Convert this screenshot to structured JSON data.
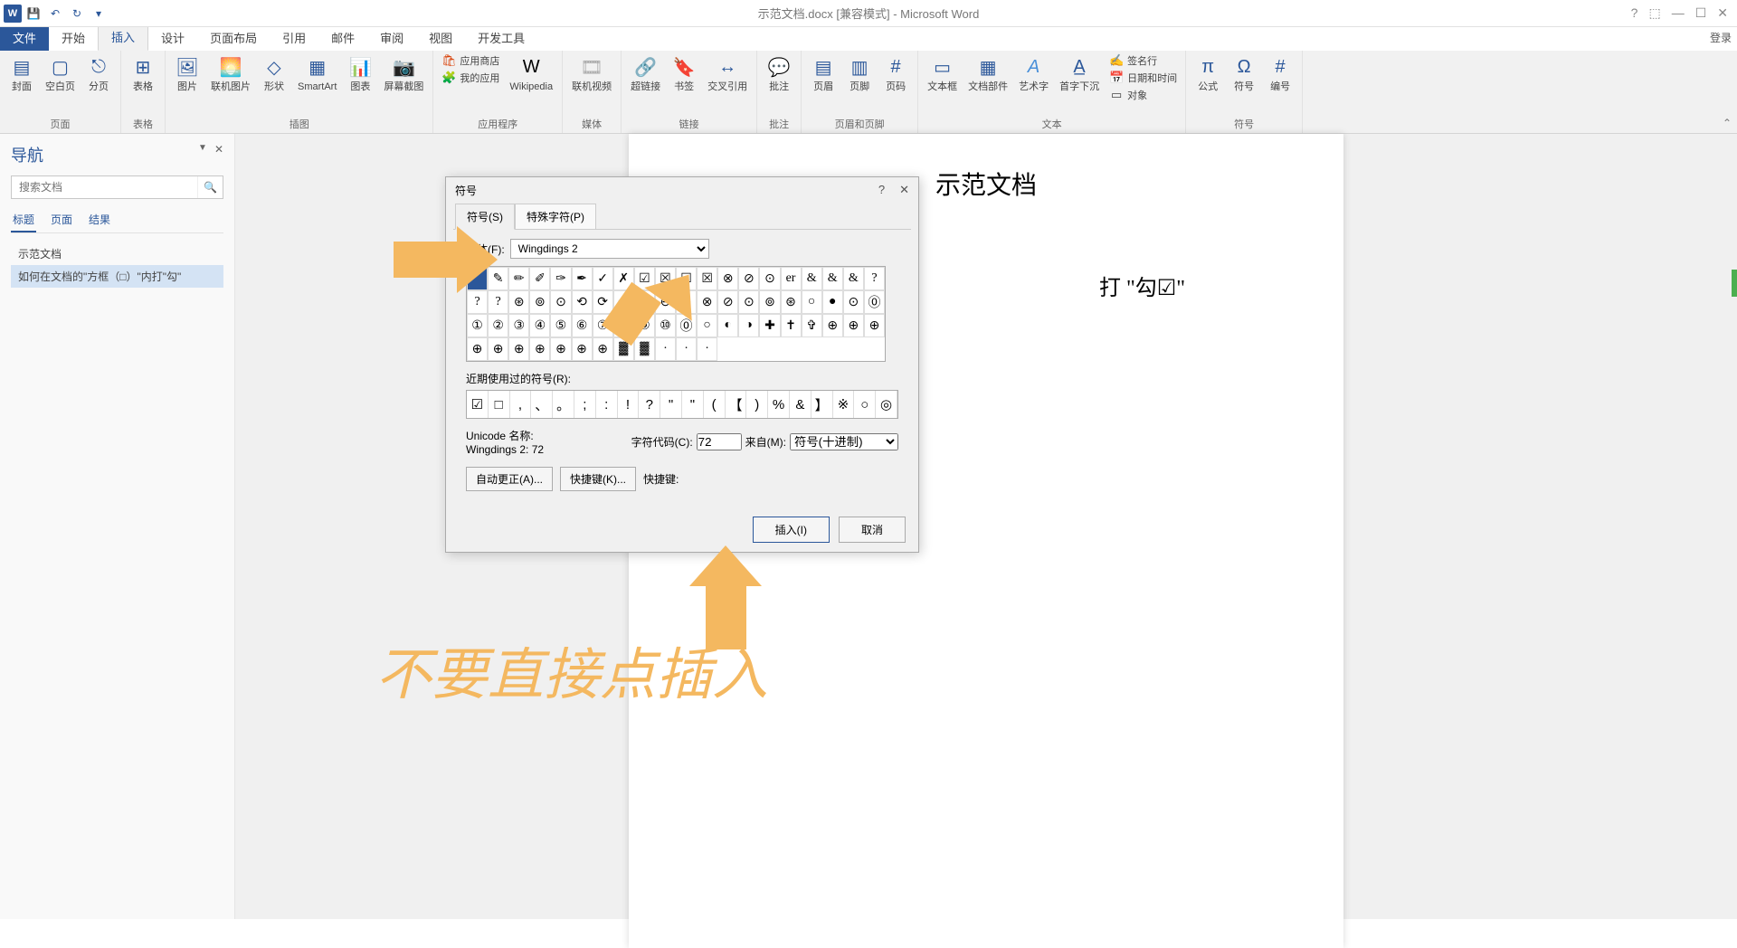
{
  "window": {
    "title": "示范文档.docx [兼容模式] - Microsoft Word",
    "login": "登录"
  },
  "tabs": {
    "file": "文件",
    "home": "开始",
    "insert": "插入",
    "design": "设计",
    "layout": "页面布局",
    "references": "引用",
    "mailings": "邮件",
    "review": "审阅",
    "view": "视图",
    "devtools": "开发工具"
  },
  "ribbon": {
    "pages": {
      "cover": "封面",
      "blank": "空白页",
      "break": "分页",
      "group": "页面"
    },
    "tables": {
      "table": "表格",
      "group": "表格"
    },
    "illus": {
      "pic": "图片",
      "online": "联机图片",
      "shape": "形状",
      "smartart": "SmartArt",
      "chart": "图表",
      "screenshot": "屏幕截图",
      "group": "插图"
    },
    "apps": {
      "store": "应用商店",
      "myapps": "我的应用",
      "wiki": "Wikipedia",
      "group": "应用程序"
    },
    "media": {
      "video": "联机视频",
      "group": "媒体"
    },
    "links": {
      "hyperlink": "超链接",
      "bookmark": "书签",
      "crossref": "交叉引用",
      "group": "链接"
    },
    "comments": {
      "comment": "批注",
      "group": "批注"
    },
    "headerfooter": {
      "header": "页眉",
      "footer": "页脚",
      "pagenum": "页码",
      "group": "页眉和页脚"
    },
    "text": {
      "textbox": "文本框",
      "quickparts": "文档部件",
      "wordart": "艺术字",
      "dropcap": "首字下沉",
      "sig": "签名行",
      "datetime": "日期和时间",
      "object": "对象",
      "group": "文本"
    },
    "symbols": {
      "equation": "公式",
      "symbol": "符号",
      "number": "编号",
      "group": "符号"
    }
  },
  "nav": {
    "title": "导航",
    "search_placeholder": "搜索文档",
    "tabs": {
      "headings": "标题",
      "pages": "页面",
      "results": "结果"
    },
    "items": [
      "示范文档",
      "如何在文档的\"方框（□）\"内打\"勾\""
    ]
  },
  "document": {
    "title": "示范文档",
    "line": "打 \"勾☑\""
  },
  "dialog": {
    "title": "符号",
    "tab_symbol": "符号(S)",
    "tab_special": "特殊字符(P)",
    "font_label": "字体(F):",
    "font_value": "Wingdings 2",
    "recent_label": "近期使用过的符号(R):",
    "recent": [
      "☑",
      "□",
      ",",
      "、",
      "。",
      ";",
      ":",
      "!",
      "?",
      "\"",
      "\"",
      "(",
      "【",
      ")",
      "%",
      "&",
      "】",
      "※",
      "○",
      "◎"
    ],
    "unicode_label": "Unicode 名称:",
    "unicode_value": "Wingdings 2: 72",
    "charcode_label": "字符代码(C):",
    "charcode_value": "72",
    "from_label": "来自(M):",
    "from_value": "符号(十进制)",
    "autocorrect": "自动更正(A)...",
    "shortcutkey": "快捷键(K)...",
    "shortcut_label": "快捷键:",
    "insert": "插入(I)",
    "cancel": "取消",
    "grid_row1": [
      "",
      "✎",
      "✏",
      "✐",
      "✑",
      "✒",
      "✓",
      "✗",
      "☑",
      "☒",
      "☑",
      "☒",
      "⊗",
      "⊘",
      "⊙",
      "er",
      "&",
      "&"
    ],
    "grid_row2": [
      "&",
      "?",
      "?",
      "?",
      "⊛",
      "⊚",
      "⊙",
      "⟲",
      "⟳",
      "↶",
      "↷",
      "⊖",
      "⊕",
      "⊗",
      "⊘",
      "⊙",
      "⊚",
      "⊛"
    ],
    "grid_row3": [
      "○",
      "●",
      "⊙",
      "⓪",
      "①",
      "②",
      "③",
      "④",
      "⑤",
      "⑥",
      "⑦",
      "⑧",
      "⑨",
      "⑩",
      "⓪",
      "○",
      "◐",
      "◑"
    ],
    "grid_row4": [
      "✚",
      "✝",
      "✞",
      "⊕",
      "⊕",
      "⊕",
      "⊕",
      "⊕",
      "⊕",
      "⊕",
      "⊕",
      "⊕",
      "⊕",
      "▓",
      "▓",
      "·",
      "·",
      "·"
    ]
  },
  "annotation": "不要直接点插入"
}
